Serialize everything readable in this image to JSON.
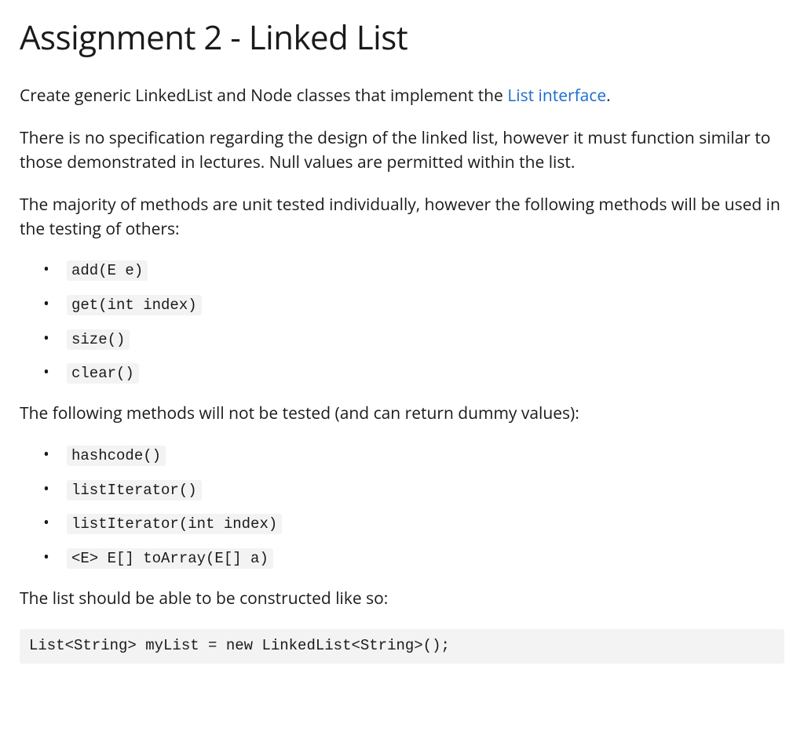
{
  "title": "Assignment 2 - Linked List",
  "intro": {
    "prefix": "Create generic LinkedList and Node classes that implement the ",
    "link_text": "List interface",
    "suffix": "."
  },
  "para2": "There is no specification regarding the design of the linked list, however it must function similar to those demonstrated in lectures. Null values are permitted within the list.",
  "para3": "The majority of methods are unit tested individually, however the following methods will be used in the testing of others:",
  "tested_methods": [
    "add(E e)",
    "get(int index)",
    "size()",
    "clear()"
  ],
  "para4": "The following methods will not be tested (and can return dummy values):",
  "untested_methods": [
    "hashcode()",
    "listIterator()",
    "listIterator(int index)",
    "<E> E[] toArray(E[] a)"
  ],
  "para5": "The list should be able to be constructed like so:",
  "code_block": "List<String> myList = new LinkedList<String>();"
}
